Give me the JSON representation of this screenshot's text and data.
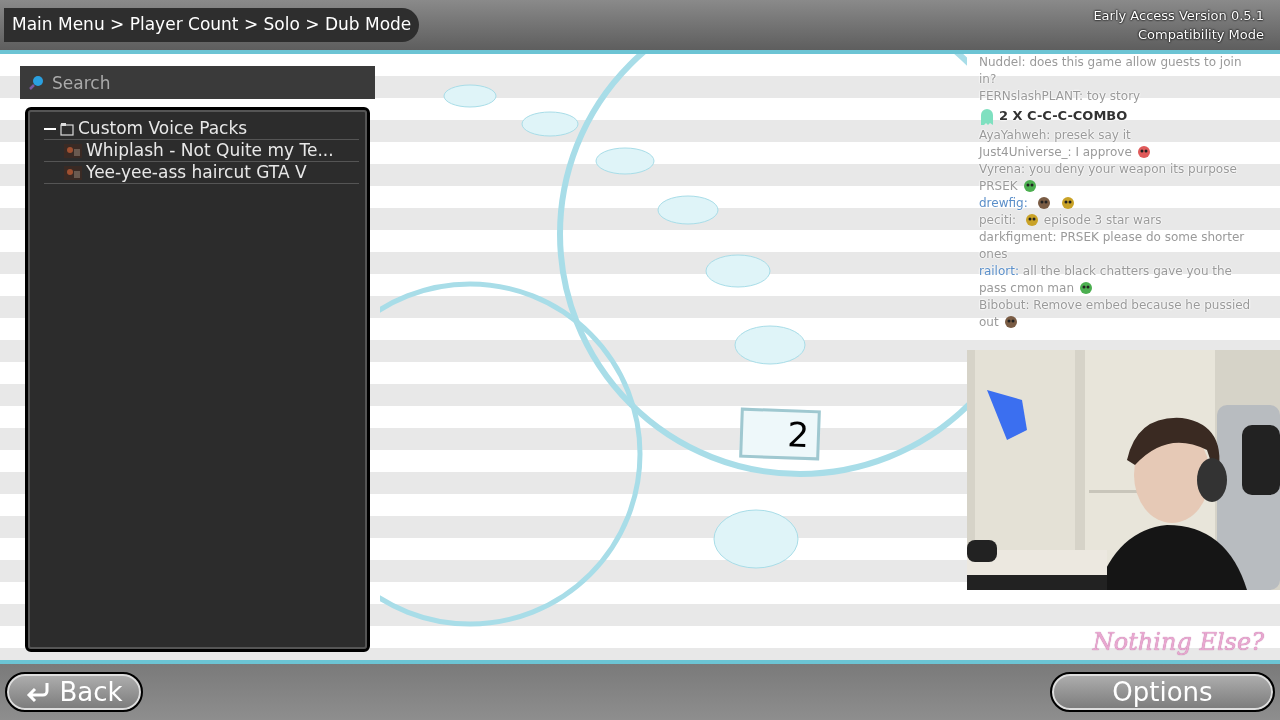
{
  "top_bar": {
    "breadcrumb": "Main Menu > Player Count > Solo > Dub Mode",
    "version": "Early Access Version 0.5.1",
    "mode": "Compatibility Mode"
  },
  "search": {
    "placeholder": "Search"
  },
  "tree": [
    {
      "label": "Custom Voice Packs",
      "expanded": true,
      "children": [
        {
          "label": "Whiplash - Not Quite my Te..."
        },
        {
          "label": "Yee-yee-ass haircut GTA V"
        }
      ]
    }
  ],
  "card": {
    "number": "2"
  },
  "chat": [
    {
      "kind": "message",
      "user": "Nuddel:",
      "color": "#9a9a9a",
      "text": "does this game allow guests to join",
      "continued": "in?"
    },
    {
      "kind": "message",
      "user": "FERNslashPLANT:",
      "color": "#9a9a9a",
      "text": "toy story"
    },
    {
      "kind": "combo",
      "text": "2 X C-C-C-COMBO"
    },
    {
      "kind": "message",
      "user": "AyaYahweh:",
      "color": "#9a9a9a",
      "text": "presek say it"
    },
    {
      "kind": "message",
      "user": "Just4Universe_:",
      "color": "#9a9a9a",
      "text": "I approve",
      "emote_after": true
    },
    {
      "kind": "message",
      "user": "Vyrena:",
      "color": "#9a9a9a",
      "text": "you deny your weapon its purpose",
      "continued": "PRSEK",
      "emote_after": true
    },
    {
      "kind": "message",
      "user": "drewfig:",
      "color": "#5b8fc9",
      "emote_after": true,
      "second_emote": true
    },
    {
      "kind": "message",
      "user": "peciti:",
      "color": "#9a9a9a",
      "text": "episode 3 star wars",
      "emote_before": true
    },
    {
      "kind": "message",
      "user": "darkfigment:",
      "color": "#9a9a9a",
      "text": "PRSEK please do some shorter",
      "continued": "ones"
    },
    {
      "kind": "message",
      "user": "railort:",
      "color": "#5b8fc9",
      "text": "all the black chatters gave you the",
      "continued": "pass cmon man",
      "emote_after": true
    },
    {
      "kind": "message",
      "user": "Bibobut:",
      "color": "#9a9a9a",
      "text": "Remove embed because he pussied",
      "continued": "out",
      "emote_after": true
    }
  ],
  "logo": "Nothing Else?",
  "buttons": [
    {
      "kind": "back",
      "label": "Back"
    },
    {
      "kind": "options",
      "label": "Options"
    }
  ]
}
